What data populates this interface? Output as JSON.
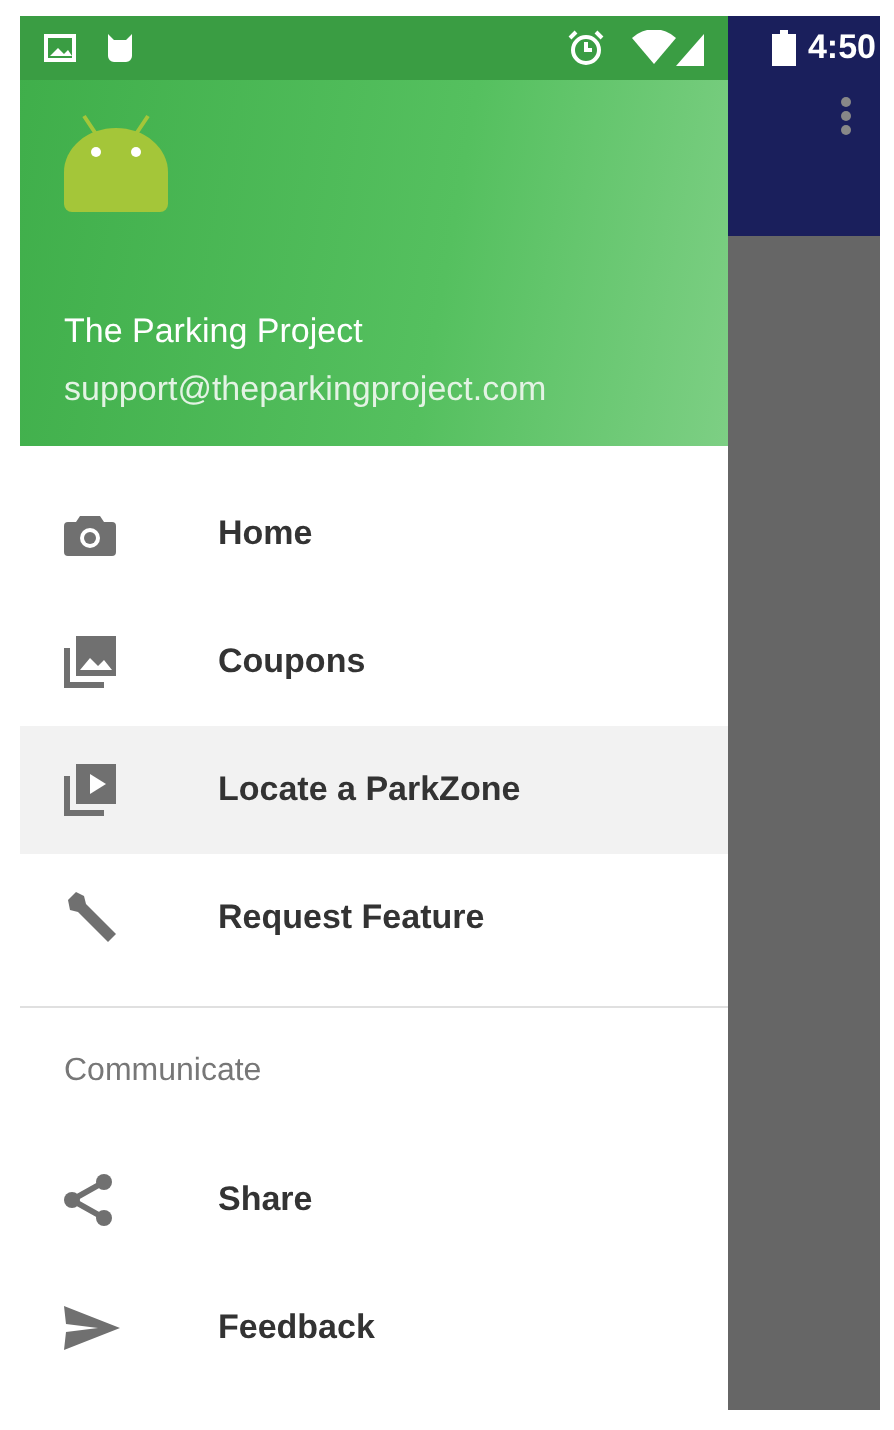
{
  "status_bar": {
    "time": "4:50"
  },
  "header": {
    "title": "The Parking Project",
    "email": "support@theparkingproject.com"
  },
  "menu": [
    {
      "label": "Home",
      "selected": false
    },
    {
      "label": "Coupons",
      "selected": false
    },
    {
      "label": "Locate a ParkZone",
      "selected": true
    },
    {
      "label": "Request Feature",
      "selected": false
    }
  ],
  "section": {
    "title": "Communicate",
    "items": [
      {
        "label": "Share",
        "selected": false
      },
      {
        "label": "Feedback",
        "selected": false
      }
    ]
  }
}
